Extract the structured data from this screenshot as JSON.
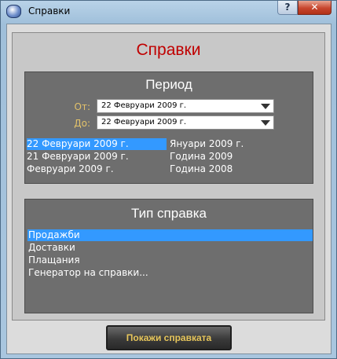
{
  "window": {
    "title": "Справки",
    "help_label": "?",
    "close_label": "✕"
  },
  "main": {
    "title": "Справки"
  },
  "period": {
    "heading": "Период",
    "from_label": "От:",
    "from_value": "22 Февруари 2009 г.",
    "to_label": "До:",
    "to_value": "22 Февруари 2009 г.",
    "quick": [
      "22 Февруари 2009 г.",
      "21 Февруари 2009 г.",
      "Февруари 2009 г.",
      "Януари 2009 г.",
      "Година 2009",
      "Година 2008"
    ]
  },
  "report_type": {
    "heading": "Тип справка",
    "items": [
      "Продажби",
      "Доставки",
      "Плащания",
      "Генератор на справки..."
    ]
  },
  "actions": {
    "show_label": "Покажи справката"
  },
  "colors": {
    "title_red": "#c00000",
    "selection_blue": "#3399ff",
    "label_gold": "#e3c26a"
  }
}
